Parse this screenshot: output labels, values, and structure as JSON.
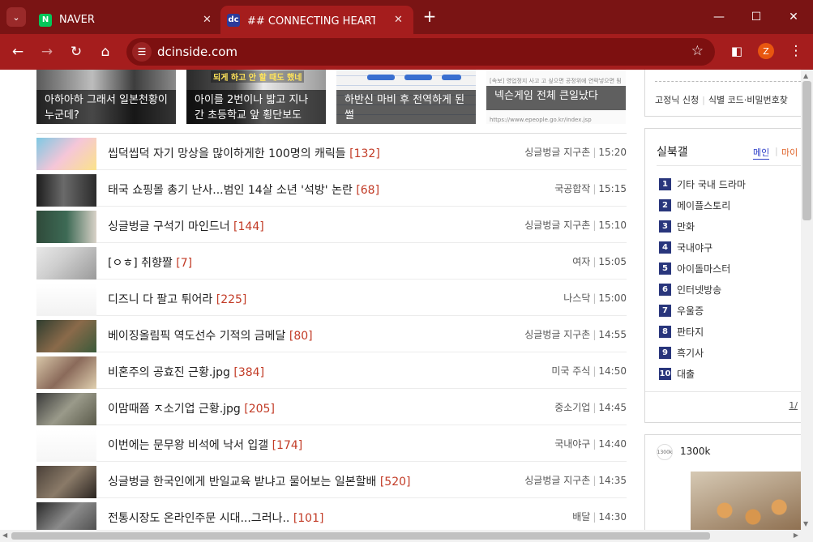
{
  "browser": {
    "tabs": [
      {
        "label": "NAVER",
        "favicon": "N"
      },
      {
        "label": "## CONNECTING HEARTS! 디시",
        "favicon": "dc"
      }
    ],
    "url": "dcinside.com",
    "profile_initial": "Z"
  },
  "thumbnails": [
    {
      "caption": "아하아하 그래서 일본천황이 누군데?"
    },
    {
      "caption": "아이를 2번이나 밟고 지나간 초등학교 앞 횡단보도",
      "overlay_text": "되게 하고 안 할 때도 했네"
    },
    {
      "caption": "하반신 마비 후 전역하게 된 썰"
    },
    {
      "caption": "넥슨게임 전체 큰일났다",
      "small_text_top": "[속보] 영업정지 사고 고 싶으면 공정위에 연락넣으면 됨",
      "small_text_bottom": "https://www.epeople.go.kr/index.jsp"
    }
  ],
  "posts": [
    {
      "title": "씹덕씹덕 자기 망상을 많이하게한 100명의 캐릭들",
      "comments": "[132]",
      "gallery": "싱글벙글 지구촌",
      "time": "15:20"
    },
    {
      "title": "태국 쇼핑몰 총기 난사...범인 14살 소년 '석방' 논란",
      "comments": "[68]",
      "gallery": "국공합작",
      "time": "15:15"
    },
    {
      "title": "싱글벙글 구석기 마인드너",
      "comments": "[144]",
      "gallery": "싱글벙글 지구촌",
      "time": "15:10"
    },
    {
      "title": "[ㅇㅎ] 취향짤",
      "comments": "[7]",
      "gallery": "여자",
      "time": "15:05"
    },
    {
      "title": "디즈니 다 팔고 튀어라",
      "comments": "[225]",
      "gallery": "나스닥",
      "time": "15:00"
    },
    {
      "title": "베이징올림픽 역도선수 기적의 금메달",
      "comments": "[80]",
      "gallery": "싱글벙글 지구촌",
      "time": "14:55"
    },
    {
      "title": "비혼주의 공효진 근황.jpg",
      "comments": "[384]",
      "gallery": "미국 주식",
      "time": "14:50"
    },
    {
      "title": "이맘때쯤 ㅈ소기업 근황.jpg",
      "comments": "[205]",
      "gallery": "중소기업",
      "time": "14:45"
    },
    {
      "title": "이번에는 문무왕 비석에 낙서 입갤",
      "comments": "[174]",
      "gallery": "국내야구",
      "time": "14:40"
    },
    {
      "title": "싱글벙글 한국인에게 반일교육 받냐고 물어보는 일본할배",
      "comments": "[520]",
      "gallery": "싱글벙글 지구촌",
      "time": "14:35"
    },
    {
      "title": "전통시장도 온라인주문 시대...그러나..",
      "comments": "[101]",
      "gallery": "배달",
      "time": "14:30"
    }
  ],
  "sidebar": {
    "links": [
      "고정닉 신청",
      "식별 코드·비밀번호찾"
    ],
    "realtime": {
      "title": "실북갤",
      "tab_main": "메인",
      "tab_my": "마이",
      "items": [
        "기타 국내 드라마",
        "메이플스토리",
        "만화",
        "국내야구",
        "아이돌마스터",
        "인터넷방송",
        "우울증",
        "판타지",
        "흑기사",
        "대출"
      ],
      "pager": "1/"
    },
    "ad": {
      "badge": "1300k",
      "count": "1300k"
    }
  }
}
